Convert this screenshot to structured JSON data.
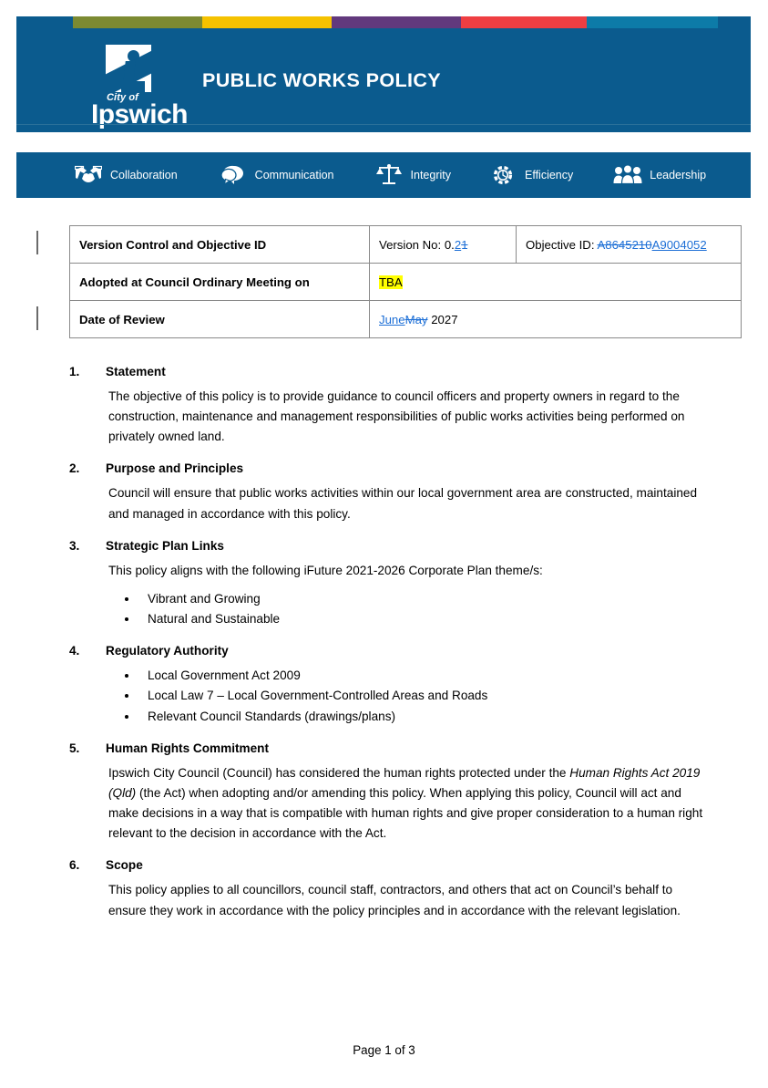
{
  "document": {
    "header": {
      "title": "PUBLIC WORKS POLICY",
      "logo_cityof": "City of",
      "logo_word": "Ipswich",
      "banner_color": "#0b5b8e",
      "colorbar": [
        {
          "name": "olive",
          "color": "#7c8a32"
        },
        {
          "name": "gold",
          "color": "#f5c200"
        },
        {
          "name": "purple",
          "color": "#62397d"
        },
        {
          "name": "red",
          "color": "#ef3e42"
        },
        {
          "name": "teal",
          "color": "#0d7ba8"
        }
      ]
    },
    "values_bar": [
      {
        "icon": "handshake-icon",
        "label": "Collaboration"
      },
      {
        "icon": "speech-bubbles-icon",
        "label": "Communication"
      },
      {
        "icon": "scales-icon",
        "label": "Integrity"
      },
      {
        "icon": "gear-icon",
        "label": "Efficiency"
      },
      {
        "icon": "people-icon",
        "label": "Leadership"
      }
    ],
    "version_table": {
      "row1": {
        "label": "Version Control and Objective ID",
        "version_prefix": "Version No: 0.",
        "version_inserted": "2",
        "version_deleted": "1",
        "objective_prefix": "Objective ID: ",
        "objective_deleted": "A8645210",
        "objective_inserted": "A9004052"
      },
      "row2": {
        "label": "Adopted at Council Ordinary Meeting on",
        "value_highlighted": "TBA"
      },
      "row3": {
        "label": "Date of Review",
        "inserted": "June",
        "deleted": "May",
        "rest": " 2027"
      }
    },
    "sections": [
      {
        "number": "1.",
        "title": "Statement",
        "paragraph": "The objective of this policy is to provide guidance to council officers and property owners in regard to the construction, maintenance and management responsibilities of public works activities being performed on privately owned land."
      },
      {
        "number": "2.",
        "title": "Purpose and Principles",
        "paragraph": "Council will ensure that public works activities within our local government area are constructed, maintained and managed in accordance with this policy."
      },
      {
        "number": "3.",
        "title": "Strategic Plan Links",
        "paragraph": "This policy aligns with the following iFuture 2021-2026 Corporate Plan theme/s:",
        "bullets": [
          "Vibrant and Growing",
          "Natural and Sustainable"
        ]
      },
      {
        "number": "4.",
        "title": "Regulatory Authority",
        "bullets": [
          "Local Government Act 2009",
          "Local Law 7 – Local Government-Controlled Areas and Roads",
          "Relevant Council Standards (drawings/plans)"
        ]
      },
      {
        "number": "5.",
        "title": "Human Rights Commitment",
        "paragraph_part1": "Ipswich City Council (Council) has considered the human rights protected under the ",
        "paragraph_italic": "Human Rights Act 2019 (Qld)",
        "paragraph_part2": " (the Act) when adopting and/or amending this policy.  When applying this policy, Council will act and make decisions in a way that is compatible with human rights and give proper consideration to a human right relevant to the decision in accordance with the Act."
      },
      {
        "number": "6.",
        "title": "Scope",
        "paragraph": "This policy applies to all councillors, council staff, contractors, and others that act on Council’s behalf to ensure they work in accordance with the policy principles and in accordance with the relevant legislation."
      }
    ],
    "footer": {
      "page_text": "Page 1 of 3"
    }
  }
}
